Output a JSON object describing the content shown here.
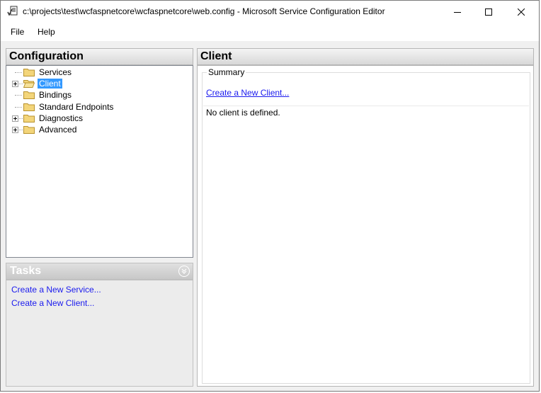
{
  "window": {
    "title": "c:\\projects\\test\\wcfaspnetcore\\wcfaspnetcore\\web.config - Microsoft Service Configuration Editor",
    "icon": "config-editor-icon"
  },
  "menu": {
    "file": "File",
    "help": "Help"
  },
  "configuration": {
    "header": "Configuration",
    "tree": [
      {
        "label": "Services",
        "expandable": false,
        "selected": false
      },
      {
        "label": "Client",
        "expandable": true,
        "selected": true
      },
      {
        "label": "Bindings",
        "expandable": false,
        "selected": false
      },
      {
        "label": "Standard Endpoints",
        "expandable": false,
        "selected": false
      },
      {
        "label": "Diagnostics",
        "expandable": true,
        "selected": false
      },
      {
        "label": "Advanced",
        "expandable": true,
        "selected": false
      }
    ]
  },
  "tasks": {
    "header": "Tasks",
    "links": [
      "Create a New Service...",
      "Create a New Client..."
    ]
  },
  "client": {
    "header": "Client",
    "summary_legend": "Summary",
    "create_link": "Create a New Client...",
    "status": "No client is defined."
  },
  "colors": {
    "selection": "#3399ff",
    "link": "#1a1aee"
  }
}
